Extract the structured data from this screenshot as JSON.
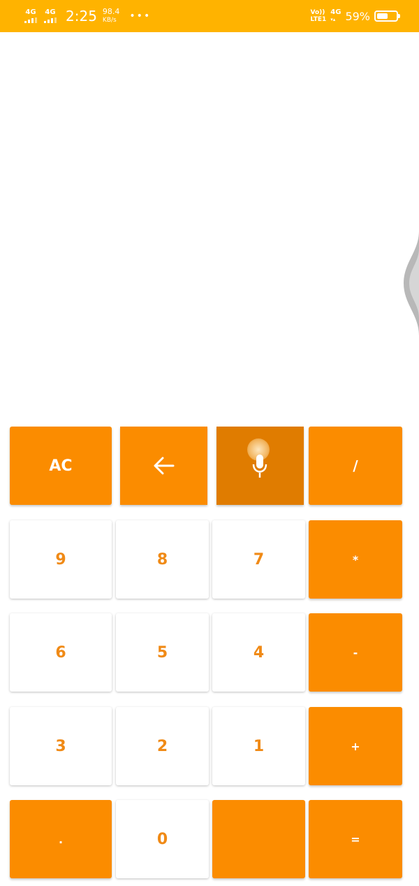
{
  "status_bar": {
    "sim1": "4G",
    "sim2": "4G",
    "time": "2:25",
    "speed_value": "98.4",
    "speed_unit": "KB/s",
    "dots": "•••",
    "volte_top": "Vo))",
    "volte_bottom": "LTE1",
    "net_type": "4G",
    "net_sub": "▾▴",
    "battery_percent": "59%",
    "battery_level": 0.59
  },
  "keypad": {
    "row1": {
      "clear": "AC",
      "divide": "/"
    },
    "row2": {
      "nine": "9",
      "eight": "8",
      "seven": "7",
      "multiply": "*"
    },
    "row3": {
      "six": "6",
      "five": "5",
      "four": "4",
      "subtract": "-"
    },
    "row4": {
      "three": "3",
      "two": "2",
      "one": "1",
      "add": "+"
    },
    "row5": {
      "dot": ".",
      "zero": "0",
      "blank": "",
      "equals": "="
    }
  },
  "icons": {
    "backspace": "arrow-left-icon",
    "voice": "microphone-icon"
  },
  "colors": {
    "status_bar": "#ffb300",
    "operator_key": "#fb8c00",
    "digit_text": "#f08a16"
  }
}
